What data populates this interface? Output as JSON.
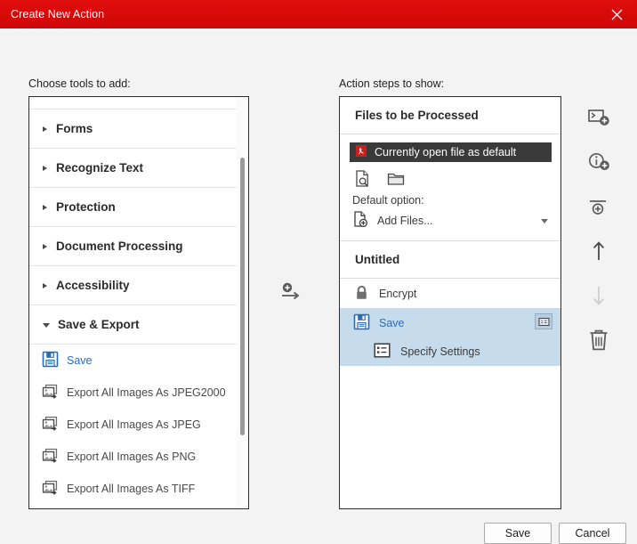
{
  "window": {
    "title": "Create New Action",
    "close_icon": "close-icon",
    "accent_color": "#d90b0b"
  },
  "left": {
    "label": "Choose tools to add:",
    "categories": [
      {
        "label": "Forms",
        "expanded": false
      },
      {
        "label": "Recognize Text",
        "expanded": false
      },
      {
        "label": "Protection",
        "expanded": false
      },
      {
        "label": "Document Processing",
        "expanded": false
      },
      {
        "label": "Accessibility",
        "expanded": false
      },
      {
        "label": "Save & Export",
        "expanded": true
      }
    ],
    "tools": [
      {
        "label": "Save",
        "icon": "save-floppy-icon",
        "selected": true
      },
      {
        "label": "Export All Images As JPEG2000",
        "icon": "export-images-icon",
        "selected": false
      },
      {
        "label": "Export All Images As JPEG",
        "icon": "export-images-icon",
        "selected": false
      },
      {
        "label": "Export All Images As PNG",
        "icon": "export-images-icon",
        "selected": false
      },
      {
        "label": "Export All Images As TIFF",
        "icon": "export-images-icon",
        "selected": false
      }
    ],
    "scrollbar": "vertical-scrollbar"
  },
  "center": {
    "add_button_icon": "add-step-arrow-icon"
  },
  "right": {
    "label": "Action steps to show:",
    "sections": [
      {
        "title": "Files to be Processed"
      },
      {
        "title": "Untitled"
      }
    ],
    "files": {
      "default_file_row": "Currently open file as default",
      "default_file_icon": "pdf-file-icon",
      "icons": [
        {
          "name": "document-search-icon"
        },
        {
          "name": "folder-icon"
        }
      ],
      "default_option_label": "Default option:",
      "default_option_value": "Add Files...",
      "default_option_icon": "file-add-icon",
      "dropdown_icon": "chevron-down-icon"
    },
    "steps": [
      {
        "label": "Encrypt",
        "icon": "lock-icon",
        "selected": false,
        "indent": false
      },
      {
        "label": "Save",
        "icon": "save-floppy-icon",
        "selected": true,
        "indent": false,
        "settings_button": "step-settings-icon"
      },
      {
        "label": "Specify Settings",
        "icon": "settings-list-icon",
        "selected": true,
        "indent": true
      }
    ]
  },
  "toolbar": {
    "buttons": [
      {
        "name": "add-panel-icon",
        "enabled": true
      },
      {
        "name": "add-instruction-icon",
        "enabled": true
      },
      {
        "name": "add-divider-icon",
        "enabled": true
      },
      {
        "name": "move-up-icon",
        "enabled": true
      },
      {
        "name": "move-down-icon",
        "enabled": false
      },
      {
        "name": "delete-trash-icon",
        "enabled": true
      }
    ]
  },
  "footer": {
    "save_label": "Save",
    "cancel_label": "Cancel"
  }
}
